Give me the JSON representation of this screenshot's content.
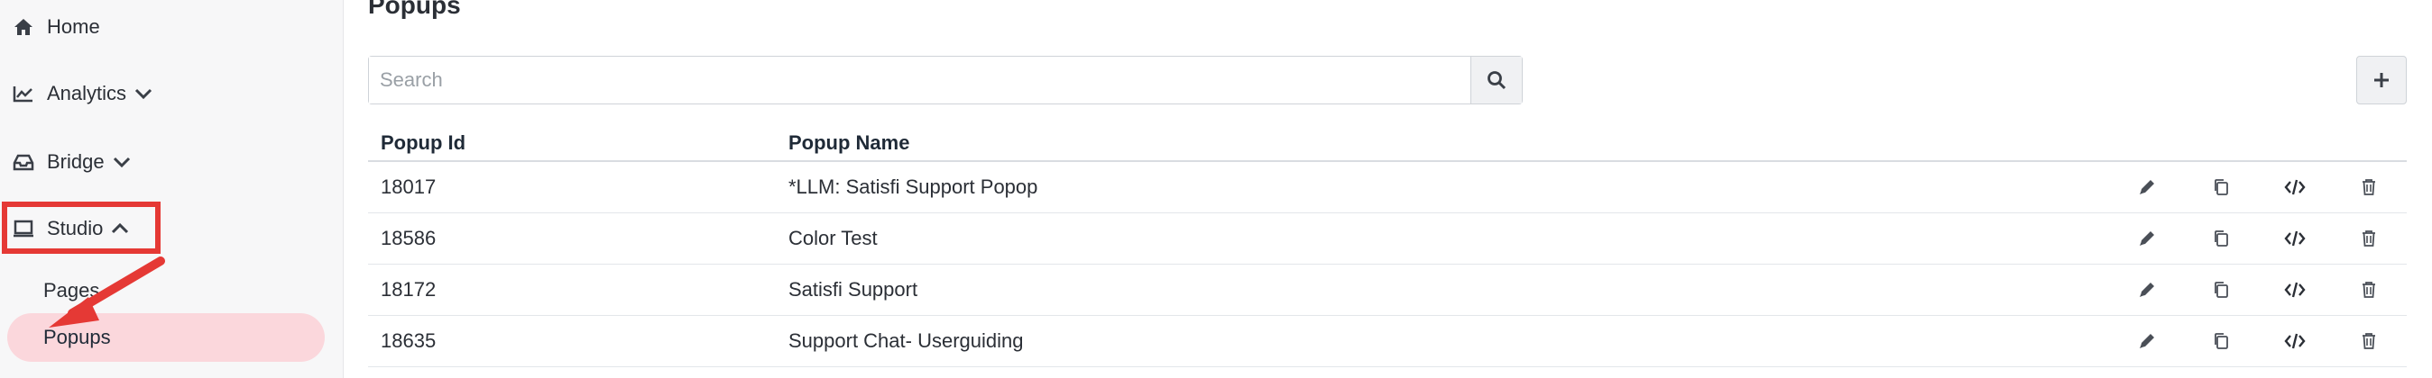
{
  "sidebar": {
    "items": [
      {
        "label": "Home",
        "icon": "home-icon"
      },
      {
        "label": "Analytics",
        "icon": "chart-line-icon"
      },
      {
        "label": "Bridge",
        "icon": "inbox-icon"
      },
      {
        "label": "Studio",
        "icon": "monitor-icon"
      }
    ],
    "subitems": [
      {
        "label": "Pages"
      },
      {
        "label": "Popups"
      }
    ],
    "active_item": "Popups",
    "highlight_color": "#e53935",
    "active_bg": "#fbd7dc"
  },
  "main": {
    "title": "Popups",
    "search": {
      "placeholder": "Search",
      "value": ""
    },
    "table": {
      "headers": [
        "Popup Id",
        "Popup Name"
      ],
      "rows": [
        {
          "id": "18017",
          "name": "*LLM: Satisfi Support Popop"
        },
        {
          "id": "18586",
          "name": "Color Test"
        },
        {
          "id": "18172",
          "name": "Satisfi Support"
        },
        {
          "id": "18635",
          "name": "Support Chat- Userguiding"
        }
      ]
    }
  }
}
